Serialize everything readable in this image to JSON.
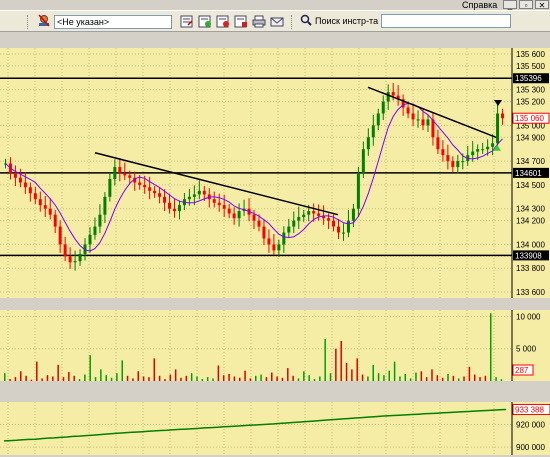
{
  "menu": {
    "help_label": "Справка"
  },
  "window_controls": {
    "minimize": "_",
    "restore": "▫",
    "close": "✕"
  },
  "toolbar": {
    "account_select_value": "<Не указан>",
    "search_label": "Поиск инстр-та",
    "search_value": ""
  },
  "price_chart": {
    "y_ticks": [
      "135 600",
      "135 500",
      "135 300",
      "135 200",
      "135 000",
      "134 900",
      "134 700",
      "134 500",
      "134 300",
      "134 200",
      "134 000",
      "133 900",
      "133 800",
      "133 600"
    ],
    "levels": [
      {
        "label": "135396",
        "value": 135396
      },
      {
        "label": "134601",
        "value": 134601
      },
      {
        "label": "133908",
        "value": 133908
      }
    ],
    "current_price_label": "135 060",
    "up_color": "#008000",
    "down_color": "#ff0000",
    "ma_color": "#8000ff"
  },
  "volume_chart": {
    "y_ticks": [
      "10 000",
      "5 000"
    ],
    "last_label": "287"
  },
  "indicator_chart": {
    "y_ticks": [
      "933 388",
      "920 000",
      "900 000"
    ]
  },
  "chart_data": [
    {
      "type": "line",
      "title": "",
      "xlabel": "",
      "ylabel": "",
      "ylim": [
        133550,
        135650
      ],
      "grid": true,
      "series": [
        {
          "values": [
            134680,
            134600,
            134560,
            134520,
            134480,
            134430,
            134380,
            134330,
            134300,
            134250,
            134150,
            134000,
            133900,
            133850,
            133860,
            133920,
            134000,
            134080,
            134150,
            134250,
            134400,
            134550,
            134650,
            134600,
            134580,
            134560,
            134520,
            134500,
            134480,
            134450,
            134430,
            134400,
            134350,
            134300,
            134280,
            134330,
            134380,
            134400,
            134420,
            134450,
            134420,
            134380,
            134350,
            134330,
            134300,
            134260,
            134220,
            134280,
            134300,
            134250,
            134200,
            134150,
            134050,
            134000,
            133950,
            134000,
            134100,
            134150,
            134200,
            134230,
            134250,
            134280,
            134260,
            134240,
            134220,
            134200,
            134150,
            134100,
            134100,
            134200,
            134300,
            134600,
            134800,
            134900,
            135000,
            135100,
            135200,
            135280,
            135250,
            135220,
            135150,
            135100,
            135050,
            135050,
            135000,
            135050,
            134900,
            134800,
            134750,
            134700,
            134650,
            134700,
            134700,
            134750,
            134780,
            134800,
            134800,
            134820,
            134850,
            135100,
            135060
          ]
        }
      ]
    },
    {
      "type": "bar",
      "title": "",
      "ylim": [
        0,
        11000
      ],
      "series": [
        {
          "values": [
            1200,
            300,
            600,
            1500,
            800,
            200,
            3000,
            400,
            900,
            700,
            2500,
            600,
            1400,
            800,
            300,
            1000,
            4000,
            600,
            1800,
            900,
            500,
            1200,
            3200,
            800,
            400,
            1500,
            700,
            600,
            3500,
            800,
            300,
            1000,
            1800,
            500,
            800,
            1200,
            700,
            300,
            600,
            400,
            2400,
            900,
            1100,
            700,
            500,
            1600,
            400,
            800,
            1000,
            600,
            1300,
            700,
            500,
            2000,
            800,
            400,
            1500,
            900,
            300,
            700,
            6500,
            1200,
            5000,
            6200,
            2800,
            1800,
            3500,
            1000,
            700,
            2500,
            1200,
            900,
            1600,
            3000,
            700,
            1100,
            400,
            1300,
            1500,
            600,
            1800,
            900,
            500,
            1100,
            800,
            400,
            700,
            2200,
            1000,
            600,
            800,
            10500,
            600,
            287
          ]
        }
      ]
    },
    {
      "type": "line",
      "title": "",
      "ylim": [
        893000,
        940000
      ],
      "series": [
        {
          "values": [
            905500,
            905800,
            906000,
            906500,
            906800,
            907000,
            907500,
            908000,
            908200,
            908600,
            909000,
            909500,
            909800,
            910200,
            910600,
            911000,
            911400,
            911800,
            912200,
            912600,
            913000,
            913300,
            913700,
            914000,
            914400,
            914700,
            915000,
            915400,
            915700,
            916000,
            916300,
            916600,
            917000,
            917300,
            917600,
            918000,
            918300,
            918600,
            919000,
            919300,
            919600,
            920000,
            920300,
            920600,
            921000,
            921400,
            921800,
            922200,
            922600,
            923000,
            923400,
            923800,
            924200,
            924600,
            925000,
            925400,
            925800,
            926200,
            926600,
            927000,
            927400,
            927700,
            928000,
            928300,
            928600,
            928900,
            929200,
            929500,
            929800,
            930100,
            930400,
            930700,
            931000,
            931300,
            931600,
            931900,
            932200,
            932500,
            932800,
            933100,
            933388
          ]
        }
      ]
    }
  ]
}
